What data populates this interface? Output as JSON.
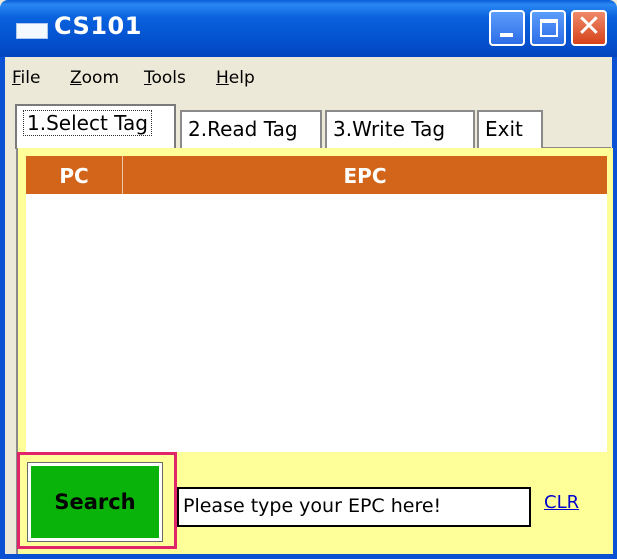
{
  "window": {
    "title": "CS101"
  },
  "menu": {
    "items": [
      {
        "label": "File",
        "accel": "F",
        "rest": "ile"
      },
      {
        "label": "Zoom",
        "accel": "Z",
        "rest": "oom"
      },
      {
        "label": "Tools",
        "accel": "T",
        "rest": "ools"
      },
      {
        "label": "Help",
        "accel": "H",
        "rest": "elp"
      }
    ]
  },
  "tabs": [
    {
      "label": "1.Select Tag",
      "active": true
    },
    {
      "label": "2.Read Tag"
    },
    {
      "label": "3.Write Tag"
    },
    {
      "label": "Exit"
    }
  ],
  "grid": {
    "columns": [
      "PC",
      "EPC"
    ],
    "rows": []
  },
  "search": {
    "button_label": "Search",
    "input_value": "Please type your EPC here!",
    "clear_label": "CLR"
  },
  "colors": {
    "header": "#d2651a",
    "panel": "#ffff9a",
    "search_button": "#09b309",
    "highlight": "#e1256a",
    "link": "#0000cc"
  }
}
